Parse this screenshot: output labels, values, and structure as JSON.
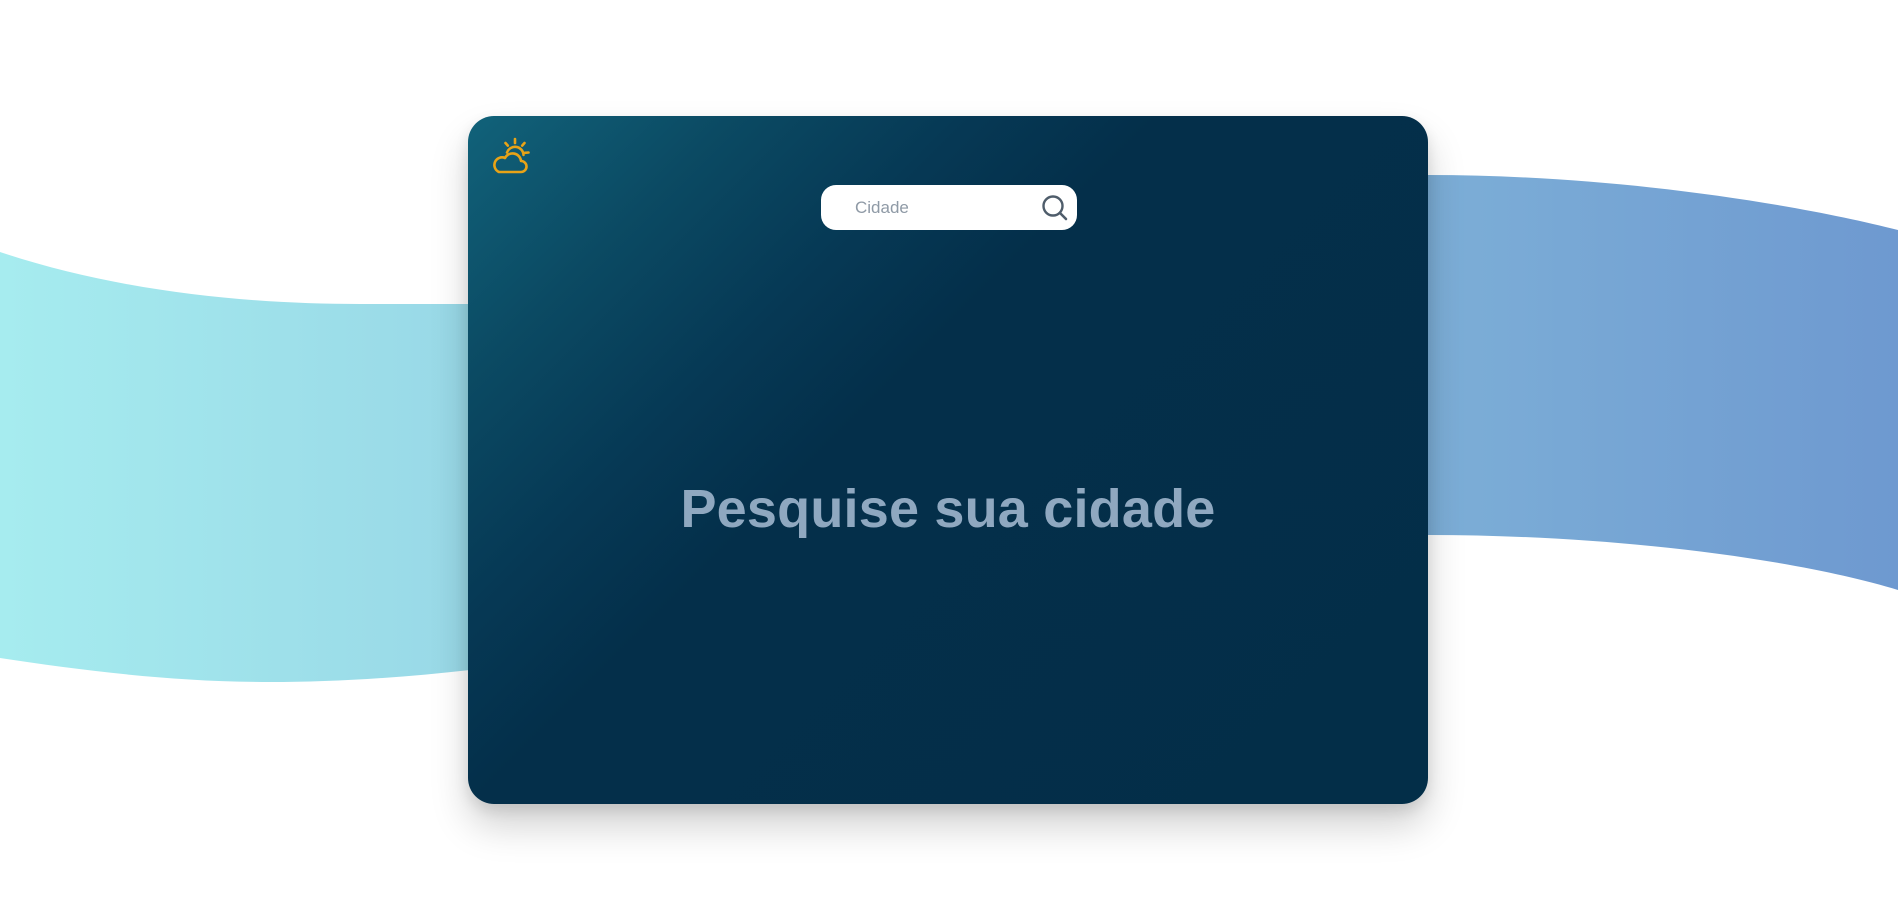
{
  "search": {
    "placeholder": "Cidade",
    "value": "",
    "button_icon": "search-icon"
  },
  "logo": {
    "icon": "cloud-sun-icon",
    "color": "#e8a317"
  },
  "main": {
    "headline": "Pesquise sua cidade"
  },
  "colors": {
    "card_dark": "#032e48",
    "card_highlight": "#11627a",
    "wave_left": "#a6ecef",
    "wave_right": "#6e99d0",
    "headline_text": "#8fa8c0"
  }
}
